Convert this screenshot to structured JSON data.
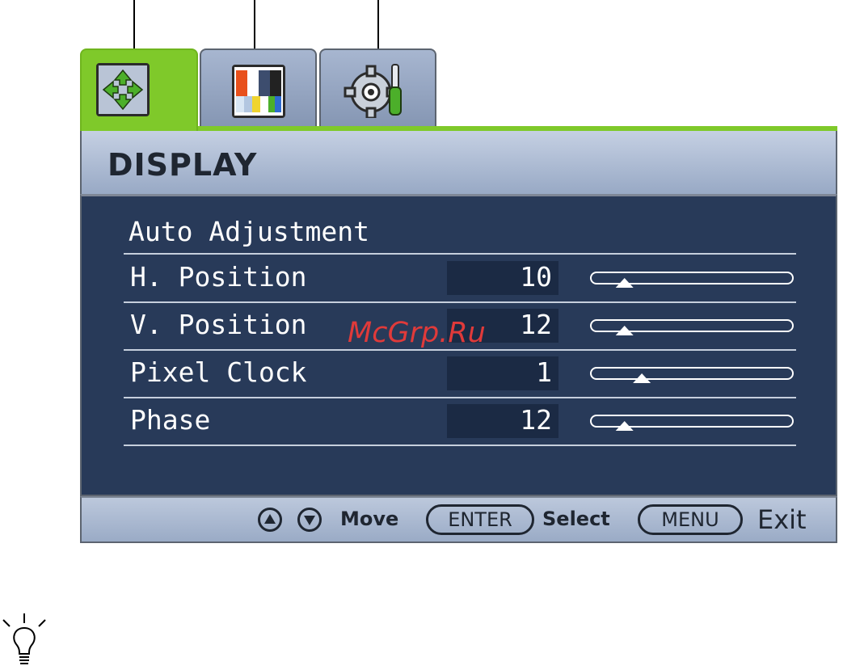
{
  "menu": {
    "tabs": [
      {
        "name": "display-tab",
        "icon": "move-arrows-icon",
        "active": true
      },
      {
        "name": "picture-tab",
        "icon": "color-bars-icon",
        "active": false
      },
      {
        "name": "system-tab",
        "icon": "gear-tool-icon",
        "active": false
      }
    ],
    "title": "DISPLAY",
    "items": [
      {
        "label": "Auto Adjustment"
      },
      {
        "label": "H. Position",
        "value": "10",
        "level": 0.15
      },
      {
        "label": "V. Position",
        "value": "12",
        "level": 0.15
      },
      {
        "label": "Pixel Clock",
        "value": "1",
        "level": 0.24
      },
      {
        "label": "Phase",
        "value": "12",
        "level": 0.15
      }
    ]
  },
  "footer": {
    "move_label": "Move",
    "enter_key": "ENTER",
    "select_label": "Select",
    "menu_key": "MENU",
    "exit_label": "Exit"
  },
  "watermark": "McGrp.Ru",
  "colors": {
    "active_tab": "#7fc92a",
    "panel": "#283a59",
    "title_bar": "#b3c0d6"
  },
  "hint_icon": "lightbulb-icon"
}
